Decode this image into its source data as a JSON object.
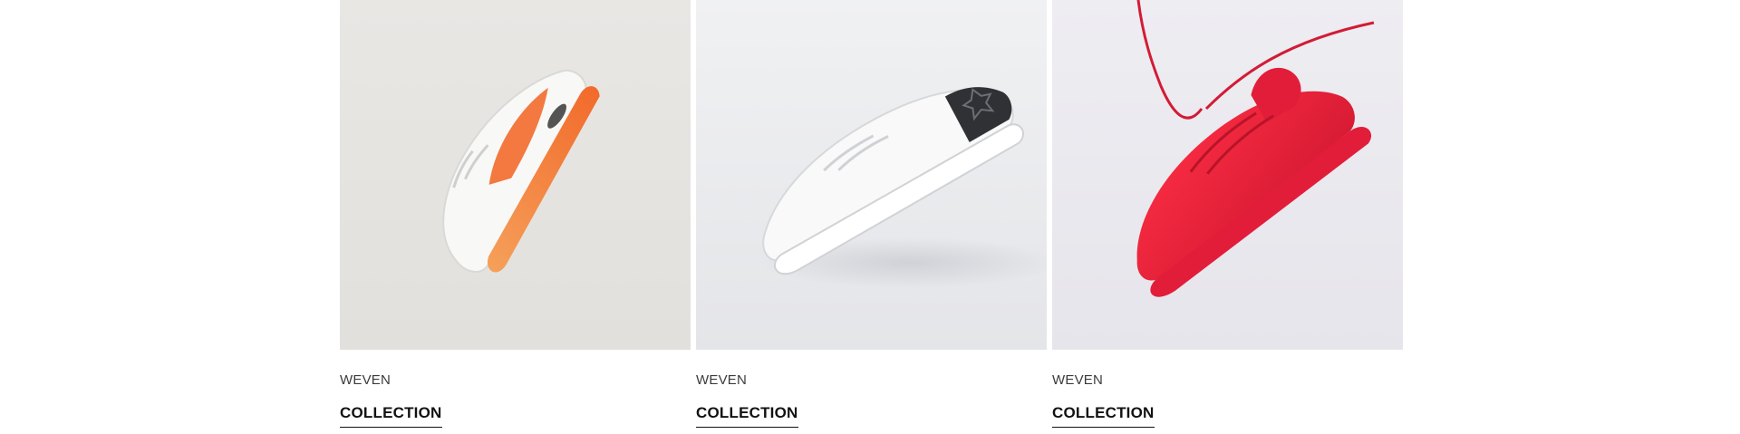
{
  "products": [
    {
      "brand": "WEVEN",
      "collection": "COLLECTION",
      "image": {
        "icon": "sneaker-orange-white-image",
        "background": "#e7e5e2",
        "primary_color": "#f26a2b",
        "accent_color": "#ffffff"
      }
    },
    {
      "brand": "WEVEN",
      "collection": "COLLECTION",
      "image": {
        "icon": "sneaker-white-black-image",
        "background": "#ecedef",
        "primary_color": "#f8f8f8",
        "accent_color": "#2f3135"
      }
    },
    {
      "brand": "WEVEN",
      "collection": "COLLECTION",
      "image": {
        "icon": "sneaker-red-hanging-image",
        "background": "#e9e8ee",
        "primary_color": "#e21d3a",
        "accent_color": "#d31b35"
      }
    }
  ]
}
